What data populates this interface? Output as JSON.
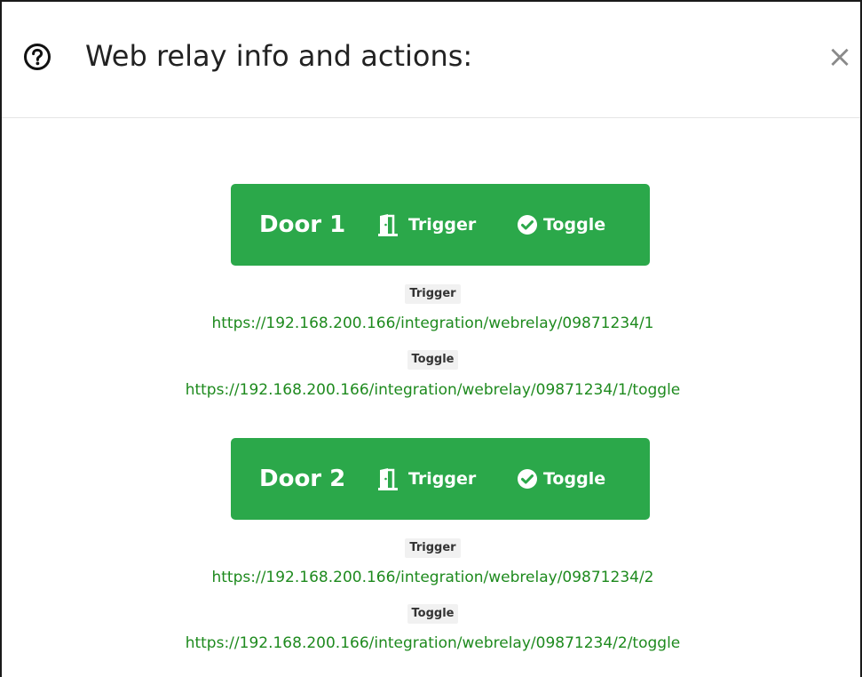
{
  "modal": {
    "title": "Web relay info and actions:",
    "close_label": "×",
    "help_icon": "question-circle-icon"
  },
  "colors": {
    "button_green": "#2ba84a",
    "link_green": "#1e8a1e",
    "pill_bg": "#f1f1f1"
  },
  "doors": [
    {
      "label": "Door 1",
      "trigger_button": "Trigger",
      "toggle_button": "Toggle",
      "trigger_tag": "Trigger",
      "trigger_url": "https://192.168.200.166/integration/webrelay/09871234/1",
      "toggle_tag": "Toggle",
      "toggle_url": "https://192.168.200.166/integration/webrelay/09871234/1/toggle"
    },
    {
      "label": "Door 2",
      "trigger_button": "Trigger",
      "toggle_button": "Toggle",
      "trigger_tag": "Trigger",
      "trigger_url": "https://192.168.200.166/integration/webrelay/09871234/2",
      "toggle_tag": "Toggle",
      "toggle_url": "https://192.168.200.166/integration/webrelay/09871234/2/toggle"
    }
  ]
}
